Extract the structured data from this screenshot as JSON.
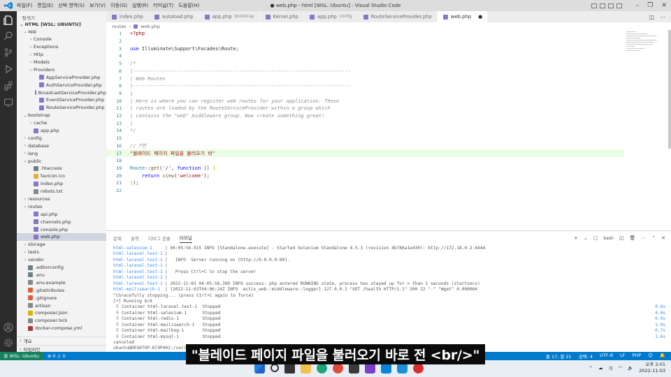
{
  "titlebar": {
    "menu": [
      "파일(F)",
      "편집(E)",
      "선택 영역(S)",
      "보기(V)",
      "이동(G)",
      "실행(R)",
      "터미널(T)",
      "도움말(H)"
    ],
    "title": "● web.php - html [WSL: Ubuntu] - Visual Studio Code"
  },
  "sidebar": {
    "header": "탐색기",
    "workspace": "HTML [WSL: UBUNTU]",
    "tree": [
      {
        "label": "app",
        "depth": 0,
        "kind": "folder-open"
      },
      {
        "label": "Console",
        "depth": 1,
        "kind": "folder"
      },
      {
        "label": "Exceptions",
        "depth": 1,
        "kind": "folder"
      },
      {
        "label": "Http",
        "depth": 1,
        "kind": "folder"
      },
      {
        "label": "Models",
        "depth": 1,
        "kind": "folder"
      },
      {
        "label": "Providers",
        "depth": 1,
        "kind": "folder-open"
      },
      {
        "label": "AppServiceProvider.php",
        "depth": 2,
        "kind": "php"
      },
      {
        "label": "AuthServiceProvider.php",
        "depth": 2,
        "kind": "php"
      },
      {
        "label": "BroadcastServiceProvider.php",
        "depth": 2,
        "kind": "php"
      },
      {
        "label": "EventServiceProvider.php",
        "depth": 2,
        "kind": "php"
      },
      {
        "label": "RouteServiceProvider.php",
        "depth": 2,
        "kind": "php"
      },
      {
        "label": "bootstrap",
        "depth": 0,
        "kind": "folder-open"
      },
      {
        "label": "cache",
        "depth": 1,
        "kind": "folder"
      },
      {
        "label": "app.php",
        "depth": 1,
        "kind": "php"
      },
      {
        "label": "config",
        "depth": 0,
        "kind": "folder"
      },
      {
        "label": "database",
        "depth": 0,
        "kind": "folder"
      },
      {
        "label": "lang",
        "depth": 0,
        "kind": "folder"
      },
      {
        "label": "public",
        "depth": 0,
        "kind": "folder-open"
      },
      {
        "label": ".htaccess",
        "depth": 1,
        "kind": "gear"
      },
      {
        "label": "favicon.ico",
        "depth": 1,
        "kind": "ico"
      },
      {
        "label": "index.php",
        "depth": 1,
        "kind": "php"
      },
      {
        "label": "robots.txt",
        "depth": 1,
        "kind": "txt"
      },
      {
        "label": "resources",
        "depth": 0,
        "kind": "folder"
      },
      {
        "label": "routes",
        "depth": 0,
        "kind": "folder-open"
      },
      {
        "label": "api.php",
        "depth": 1,
        "kind": "php"
      },
      {
        "label": "channels.php",
        "depth": 1,
        "kind": "php"
      },
      {
        "label": "console.php",
        "depth": 1,
        "kind": "php"
      },
      {
        "label": "web.php",
        "depth": 1,
        "kind": "php",
        "selected": true
      },
      {
        "label": "storage",
        "depth": 0,
        "kind": "folder"
      },
      {
        "label": "tests",
        "depth": 0,
        "kind": "folder"
      },
      {
        "label": "vendor",
        "depth": 0,
        "kind": "folder"
      },
      {
        "label": ".editorconfig",
        "depth": 0,
        "kind": "gear"
      },
      {
        "label": ".env",
        "depth": 0,
        "kind": "gear"
      },
      {
        "label": ".env.example",
        "depth": 0,
        "kind": "txt"
      },
      {
        "label": ".gitattributes",
        "depth": 0,
        "kind": "git"
      },
      {
        "label": ".gitignore",
        "depth": 0,
        "kind": "git"
      },
      {
        "label": "artisan",
        "depth": 0,
        "kind": "txt"
      },
      {
        "label": "composer.json",
        "depth": 0,
        "kind": "json"
      },
      {
        "label": "composer.lock",
        "depth": 0,
        "kind": "lock"
      },
      {
        "label": "docker-compose.yml",
        "depth": 0,
        "kind": "yml"
      }
    ],
    "outline": "개요",
    "timeline": "타임라인"
  },
  "tabs": [
    {
      "label": "index.php",
      "desc": ""
    },
    {
      "label": "autoload.php",
      "desc": ""
    },
    {
      "label": "app.php",
      "desc": "bootstrap"
    },
    {
      "label": "Kernel.php",
      "desc": ""
    },
    {
      "label": "app.php",
      "desc": "config"
    },
    {
      "label": "RouteServiceProvider.php",
      "desc": ""
    },
    {
      "label": "web.php",
      "desc": "",
      "active": true
    }
  ],
  "breadcrumb": [
    "routes",
    "web.php"
  ],
  "editor": {
    "current_line": 17,
    "lines": [
      {
        "n": "1",
        "t": "<?php"
      },
      {
        "n": "2",
        "t": ""
      },
      {
        "n": "3",
        "t": "use Illuminate\\Support\\Facades\\Route;"
      },
      {
        "n": "4",
        "t": ""
      },
      {
        "n": "5",
        "t": "/*"
      },
      {
        "n": "6",
        "t": "|--------------------------------------------------------------------------"
      },
      {
        "n": "7",
        "t": "| Web Routes"
      },
      {
        "n": "8",
        "t": "|--------------------------------------------------------------------------"
      },
      {
        "n": "9",
        "t": "|"
      },
      {
        "n": "10",
        "t": "| Here is where you can register web routes for your application. These"
      },
      {
        "n": "11",
        "t": "| routes are loaded by the RouteServiceProvider within a group which"
      },
      {
        "n": "12",
        "t": "| contains the \"web\" middleware group. Now create something great!"
      },
      {
        "n": "13",
        "t": "|"
      },
      {
        "n": "14",
        "t": "*/"
      },
      {
        "n": "15",
        "t": ""
      },
      {
        "n": "16",
        "t": "// 7번"
      },
      {
        "n": "17",
        "t": "\"블레이드 페이지 파일을 불러오기 바\""
      },
      {
        "n": "18",
        "t": ""
      },
      {
        "n": "19",
        "t": "Route::get('/', function () {"
      },
      {
        "n": "20",
        "t": "    return view('welcome');"
      },
      {
        "n": "21",
        "t": "});"
      },
      {
        "n": "22",
        "t": ""
      }
    ]
  },
  "panel": {
    "tabs": [
      "문제",
      "출력",
      "디버그 콘솔",
      "터미널"
    ],
    "active_tab": "터미널",
    "terminal_name": "bash",
    "lines": [
      {
        "svc": "html-selenium-1",
        "msg": "| 04:05:56.915 INFO [Standalone.execute] - Started Selenium Standalone 4.5.3 (revision 4b786a1e430): http://172.18.0.2:4444"
      },
      {
        "svc": "html-laravel.test-1",
        "msg": "|"
      },
      {
        "svc": "html-laravel.test-1",
        "msg": "|   INFO  Server running on [http://0.0.0.0:80]."
      },
      {
        "svc": "html-laravel.test-1",
        "msg": "|"
      },
      {
        "svc": "html-laravel.test-1",
        "msg": "|   Press Ctrl+C to stop the server"
      },
      {
        "svc": "html-laravel.test-1",
        "msg": "|"
      },
      {
        "svc": "html-laravel.test-1",
        "msg": "| 2022-11-03 04:05:58,390 INFO success: php entered RUNNING state, process has stayed up for > than 1 seconds (startsecs)"
      },
      {
        "svc": "html-meilisearch-1",
        "msg": "| [2022-11-03T04:06:24Z INFO  actix_web::middleware::logger] 127.0.0.1 \"GET /health HTTP/1.1\" 200 22 \"-\" \"Wget\" 0.000064"
      },
      {
        "svc": "",
        "msg": "^CGracefully stopping... (press Ctrl+C again to force)"
      },
      {
        "svc": "",
        "msg": "[+] Running 6/6"
      },
      {
        "svc": "",
        "msg": " ⠿ Container html-laravel.test-1  Stopped",
        "right": "0.6s"
      },
      {
        "svc": "",
        "msg": " ⠿ Container html-selenium-1      Stopped",
        "right": "4.0s"
      },
      {
        "svc": "",
        "msg": " ⠿ Container html-redis-1         Stopped",
        "right": "0.9s"
      },
      {
        "svc": "",
        "msg": " ⠿ Container html-meilisearch-1   Stopped",
        "right": "1.0s"
      },
      {
        "svc": "",
        "msg": " ⠿ Container html-mailhog-1       Stopped",
        "right": "0.7s"
      },
      {
        "svc": "",
        "msg": " ⠿ Container html-mysql-1         Stopped",
        "right": "1.6s"
      },
      {
        "svc": "",
        "msg": "canceled"
      },
      {
        "svc": "",
        "msg": "ubuntu@DESKTOP-KC9P402:/var/www/html$"
      }
    ]
  },
  "statusbar": {
    "remote": "WSL: Ubuntu",
    "problems": "⊗ 0 ⚠ 0",
    "position": "줄 17, 열 21",
    "spaces": "공백: 4",
    "encoding": "UTF-8",
    "eol": "LF",
    "language": "PHP"
  },
  "taskbar": {
    "lang": "가",
    "time": "오후 2:01",
    "date": "2022-11-03"
  },
  "subtitle": "\"블레이드 페이지 파일을 불러오기 바로 전 <br/>\"",
  "colors": {
    "accent": "#007acc",
    "remote": "#16825d",
    "activity_bar": "#2c2c2c",
    "sidebar_bg": "#f3f3f3"
  }
}
